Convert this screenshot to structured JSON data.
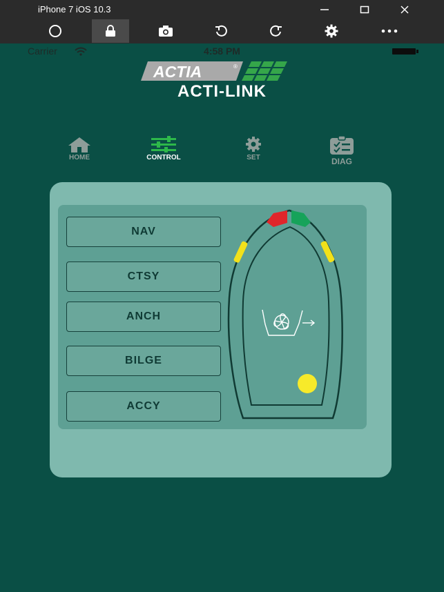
{
  "simulator": {
    "title": "iPhone 7 iOS 10.3",
    "window_controls": [
      "minimize-icon",
      "maximize-icon",
      "close-icon"
    ],
    "tools": [
      "home-icon",
      "lock-icon",
      "camera-icon",
      "rotate-left-icon",
      "rotate-right-icon",
      "gear-icon",
      "more-icon"
    ]
  },
  "status_bar": {
    "carrier": "Carrier",
    "time": "4:58 PM"
  },
  "header": {
    "logo_text": "ACTIA",
    "app_name": "ACTI-LINK"
  },
  "nav": {
    "tabs": [
      {
        "label": "HOME",
        "icon": "home-icon",
        "active": false
      },
      {
        "label": "CONTROL",
        "icon": "sliders-icon",
        "active": true
      },
      {
        "label": "SET",
        "icon": "gear-icon",
        "active": false
      },
      {
        "label": "DIAG",
        "icon": "clipboard-check-icon",
        "active": false
      }
    ]
  },
  "controls": {
    "buttons": [
      "NAV",
      "CTSY",
      "ANCH",
      "BILGE",
      "ACCY"
    ]
  },
  "colors": {
    "background": "#0a4f45",
    "panel_outer": "#7fb9ae",
    "panel_inner": "#5ea094",
    "nav_red": "#e0262b",
    "nav_green": "#16a35a",
    "light_yellow": "#f2e11a"
  }
}
